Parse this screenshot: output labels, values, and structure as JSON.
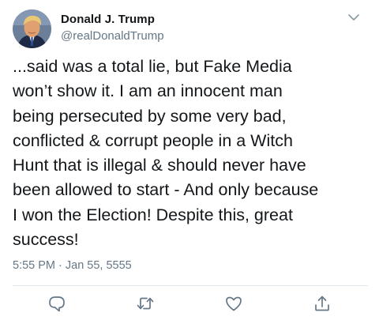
{
  "author": {
    "name": "Donald J. Trump",
    "handle": "@realDonaldTrump"
  },
  "tweet": {
    "lines": [
      "...said was a total lie, but Fake Media",
      "won’t show it. I am an innocent man",
      "being persecuted by some very bad,",
      "conflicted & corrupt people in a Witch",
      "Hunt that is illegal & should never have",
      "been allowed to start - And only because",
      "I won the Election! Despite this, great",
      "success!"
    ],
    "timestamp": "5:55 PM · Jan 55, 5555"
  },
  "actions": [
    "reply-icon",
    "retweet-icon",
    "like-icon",
    "share-icon"
  ],
  "colors": {
    "text": "#14171a",
    "secondary": "#657786",
    "divider": "#e1e8ed"
  }
}
